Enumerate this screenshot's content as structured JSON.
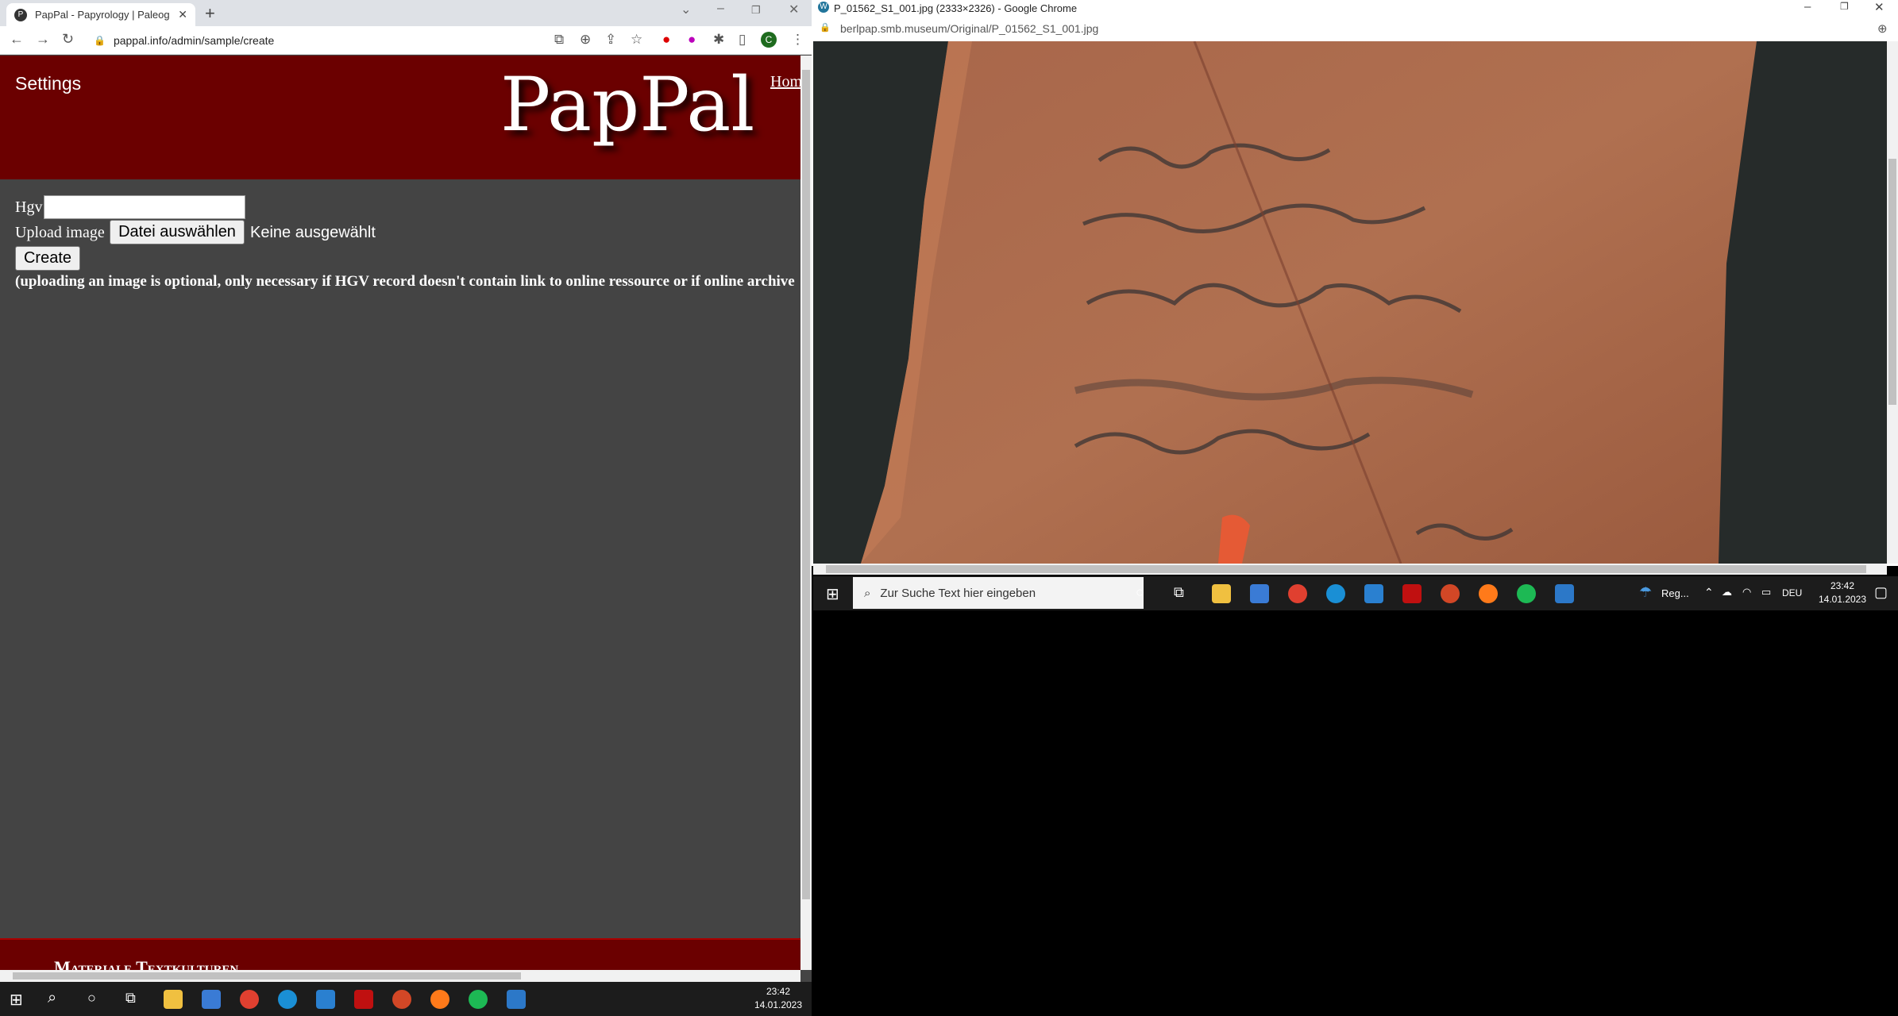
{
  "left_browser": {
    "tab_title": "PapPal - Papyrology | Paleograph",
    "favicon_letter": "P",
    "url": "pappal.info/admin/sample/create",
    "profile_letter": "C"
  },
  "page": {
    "settings_label": "Settings",
    "logo_text": "PapPal",
    "home_link": "Home",
    "hgv_label": "Hgv",
    "upload_label": "Upload image",
    "file_button": "Datei auswählen",
    "file_status": "Keine ausgewählt",
    "create_button": "Create",
    "note": "(uploading an image is optional, only necessary if HGV record doesn't contain link to online ressource or if online archive",
    "footer_text": "Materiale Textkulturen"
  },
  "right_browser": {
    "title": "P_01562_S1_001.jpg (2333×2326) - Google Chrome",
    "url": "berlpap.smb.museum/Original/P_01562_S1_001.jpg"
  },
  "taskbar_right": {
    "search_placeholder": "Zur Suche Text hier eingeben",
    "weather": "Reg...",
    "lang": "DEU",
    "time": "23:42",
    "date": "14.01.2023"
  },
  "taskbar_left": {
    "time": "23:42",
    "date": "14.01.2023"
  },
  "colors": {
    "banner": "#6b0000",
    "page_bg": "#444444"
  }
}
